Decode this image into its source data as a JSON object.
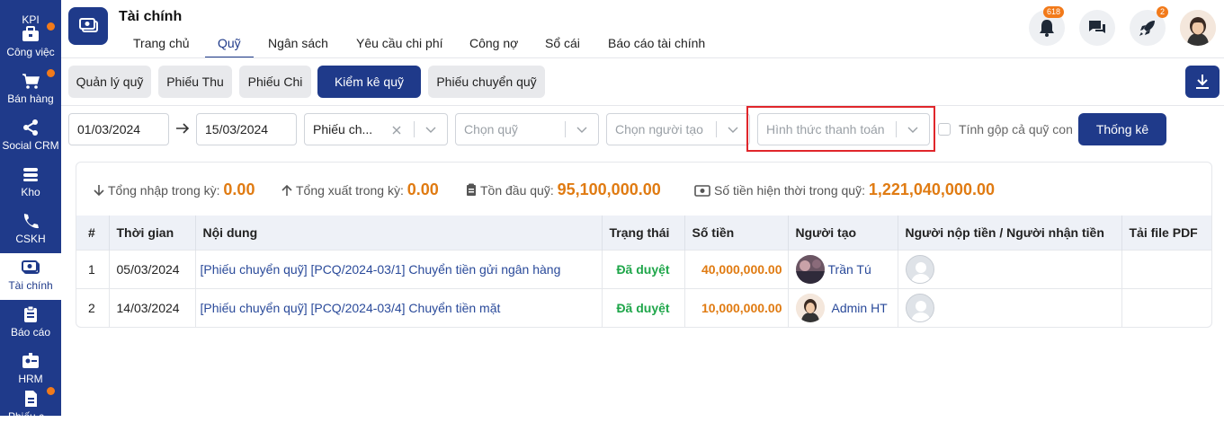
{
  "sidebar": {
    "items": [
      {
        "label": "KPI",
        "icon": "kpi-icon"
      },
      {
        "label": "Công việc",
        "icon": "briefcase-icon"
      },
      {
        "label": "Bán hàng",
        "icon": "cart-icon"
      },
      {
        "label": "Social CRM",
        "icon": "share-icon"
      },
      {
        "label": "Kho",
        "icon": "warehouse-icon"
      },
      {
        "label": "CSKH",
        "icon": "phone-icon"
      },
      {
        "label": "Tài chính",
        "icon": "finance-icon"
      },
      {
        "label": "Báo cáo",
        "icon": "clipboard-icon"
      },
      {
        "label": "HRM",
        "icon": "id-card-icon"
      },
      {
        "label": "Phiếu c...",
        "icon": "document-icon"
      }
    ],
    "bg_color": "#1f3a8a",
    "dot_color": "#f27a1a"
  },
  "header": {
    "title": "Tài chính",
    "tabs": [
      "Trang chủ",
      "Quỹ",
      "Ngân sách",
      "Yêu cầu chi phí",
      "Công nợ",
      "Sổ cái",
      "Báo cáo tài chính"
    ],
    "active_tab": "Quỹ",
    "notification_count": "618",
    "rocket_count": "2"
  },
  "subtabs": {
    "items": [
      "Quản lý quỹ",
      "Phiếu Thu",
      "Phiếu Chi",
      "Kiểm kê quỹ",
      "Phiếu chuyển quỹ"
    ],
    "active": "Kiểm kê quỹ"
  },
  "filters": {
    "date_from": "01/03/2024",
    "date_to": "15/03/2024",
    "type_value": "Phiếu ch...",
    "fund_placeholder": "Chọn quỹ",
    "creator_placeholder": "Chọn người tạo",
    "payment_placeholder": "Hình thức thanh toán",
    "include_child_label": "Tính gộp cả quỹ con",
    "submit_label": "Thống kê"
  },
  "summary": {
    "total_in_label": "Tổng nhập trong kỳ:",
    "total_in_value": "0.00",
    "total_out_label": "Tổng xuất trong kỳ:",
    "total_out_value": "0.00",
    "opening_label": "Tồn đầu quỹ:",
    "opening_value": "95,100,000.00",
    "current_label": "Số tiền hiện thời trong quỹ:",
    "current_value": "1,221,040,000.00"
  },
  "table": {
    "headers": [
      "#",
      "Thời gian",
      "Nội dung",
      "Trạng thái",
      "Số tiền",
      "Người tạo",
      "Người nộp tiền / Người nhận tiền",
      "Tải file PDF"
    ],
    "rows": [
      {
        "no": "1",
        "date": "05/03/2024",
        "content": "[Phiếu chuyển quỹ] [PCQ/2024-03/1] Chuyển tiền gửi ngân hàng",
        "status": "Đã duyệt",
        "amount": "40,000,000.00",
        "creator": "Trần Tú"
      },
      {
        "no": "2",
        "date": "14/03/2024",
        "content": "[Phiếu chuyển quỹ] [PCQ/2024-03/4] Chuyển tiền mặt",
        "status": "Đã duyệt",
        "amount": "10,000,000.00",
        "creator": "Admin HT"
      }
    ]
  },
  "colors": {
    "primary": "#1f3a8a",
    "amount": "#e07b12",
    "approved": "#1fa64a",
    "highlight": "#e0262b"
  }
}
